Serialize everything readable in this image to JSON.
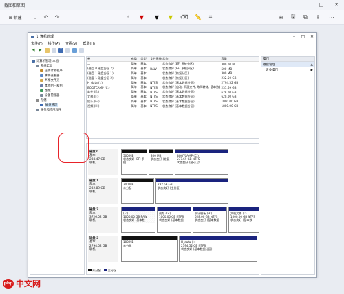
{
  "app": {
    "title": "截图和草图",
    "toolbar": {
      "new_label": "新建"
    },
    "window_controls": [
      "–",
      "□",
      "✕"
    ]
  },
  "cm": {
    "title": "计算机管理",
    "menu": [
      "文件(F)",
      "操作(A)",
      "查看(V)",
      "帮助(H)"
    ],
    "tree": [
      {
        "label": "计算机管理(本地)",
        "indent": 0
      },
      {
        "label": "系统工具",
        "indent": 1
      },
      {
        "label": "任务计划程序",
        "indent": 2
      },
      {
        "label": "事件查看器",
        "indent": 2
      },
      {
        "label": "共享文件夹",
        "indent": 2
      },
      {
        "label": "本地用户和组",
        "indent": 2
      },
      {
        "label": "性能",
        "indent": 2
      },
      {
        "label": "设备管理器",
        "indent": 2
      },
      {
        "label": "存储",
        "indent": 1
      },
      {
        "label": "磁盘管理",
        "indent": 2,
        "selected": true
      },
      {
        "label": "服务和应用程序",
        "indent": 1
      }
    ],
    "volume_headers": [
      "卷",
      "布局",
      "类型",
      "文件系统",
      "状态",
      "容量"
    ],
    "volumes": [
      [
        "—",
        "简单",
        "基本",
        "",
        "状态良好 (EFI 系统分区)",
        "300.00 M"
      ],
      [
        "(磁盘 0 磁盘分区 7)",
        "简单",
        "基本",
        "RAW",
        "状态良好 (EFI 系统分区)",
        "500 MB"
      ],
      [
        "(磁盘 1 磁盘分区 1)",
        "简单",
        "基本",
        "",
        "状态良好 (恢复分区)",
        "300 MB"
      ],
      [
        "(磁盘 1 磁盘分区 2)",
        "简单",
        "基本",
        "",
        "状态良好 (恢复分区)",
        "232.50 GB"
      ],
      [
        "H_data (I:)",
        "简单",
        "基本",
        "NTFS",
        "状态良好 (基本数据分区)",
        "2794.52 GB"
      ],
      [
        "BOOTCAMP (C:)",
        "简单",
        "基本",
        "NTFS",
        "状态良好 (启动, 页面文件, 故障转储, 基本数据分区)",
        "237.69 GB"
      ],
      [
        "软件 (E:)",
        "简单",
        "基本",
        "NTFS",
        "状态良好 (基本数据分区)",
        "628.00 GB"
      ],
      [
        "文档 (F:)",
        "简单",
        "基本",
        "NTFS",
        "状态良好 (基本数据分区)",
        "620.00 GB"
      ],
      [
        "娱乐 (G:)",
        "简单",
        "基本",
        "NTFS",
        "状态良好 (基本数据分区)",
        "1000.00 GB"
      ],
      [
        "视频 (H:)",
        "简单",
        "基本",
        "NTFS",
        "状态良好 (基本数据分区)",
        "1800.00 GB"
      ]
    ],
    "disks": [
      {
        "name": "磁盘 0",
        "type": "基本",
        "size": "238.47 GB",
        "status": "联机",
        "parts": [
          {
            "text": [
              "500 MB",
              "状态良好 (EFI 系统"
            ],
            "w": 40,
            "bar": "black"
          },
          {
            "text": [
              "300 MB",
              "状态良好 (恢复"
            ],
            "w": 38,
            "bar": "black"
          },
          {
            "text": [
              "BOOTCAMP (C:)",
              "237.69 GB NTFS",
              "状态良好 (启动, 页"
            ],
            "w": 80,
            "bar": "blue"
          }
        ]
      },
      {
        "name": "磁盘 1",
        "type": "基本",
        "size": "232.89 GB",
        "status": "联机",
        "parts": [
          {
            "text": [
              "300 MB",
              "未分配"
            ],
            "w": 50,
            "bar": "black"
          },
          {
            "text": [
              "232.59 GB",
              "状态良好 (主分区)"
            ],
            "w": 108,
            "bar": "blue"
          }
        ]
      },
      {
        "name": "磁盘 2",
        "type": "基本",
        "size": "3726.02 GB",
        "status": "联机",
        "parts": [
          {
            "text": [
              "(E:)",
              "1000.00 GB RAW",
              "状态良好 (基本数"
            ],
            "w": 52,
            "bar": "blue",
            "sel": true
          },
          {
            "text": [
              "视频 (G:)",
              "1000.00 GB NTFS",
              "状态良好 (基本数据"
            ],
            "w": 52,
            "bar": "blue"
          },
          {
            "text": [
              "娱乐模板 (H:)",
              "628.00 GB NTFS",
              "状态良好 (基本数据"
            ],
            "w": 52,
            "bar": "blue"
          },
          {
            "text": [
              "文档文件 (I:)",
              "1000.00 GB NTFS",
              "状态良好 (基本数"
            ],
            "w": 48,
            "bar": "blue"
          }
        ]
      },
      {
        "name": "磁盘 3",
        "type": "基本",
        "size": "2794.52 GB",
        "status": "联机",
        "parts": [
          {
            "text": [
              "100 MB",
              "未分配"
            ],
            "w": 84,
            "bar": "black"
          },
          {
            "text": [
              "H_data (I:)",
              "2794.52 GB NTFS",
              "状态良好 (基本数据分区)"
            ],
            "w": 116,
            "bar": "blue"
          }
        ]
      }
    ],
    "legend": [
      "未分配",
      "主分区"
    ],
    "actions": {
      "header": "操作",
      "sub": "磁盘管理",
      "item": "更多操作"
    }
  },
  "watermark": "中文网",
  "colors": {
    "primary_partition": "#1a237e",
    "unallocated": "#111111",
    "highlight": "#e8232a"
  }
}
